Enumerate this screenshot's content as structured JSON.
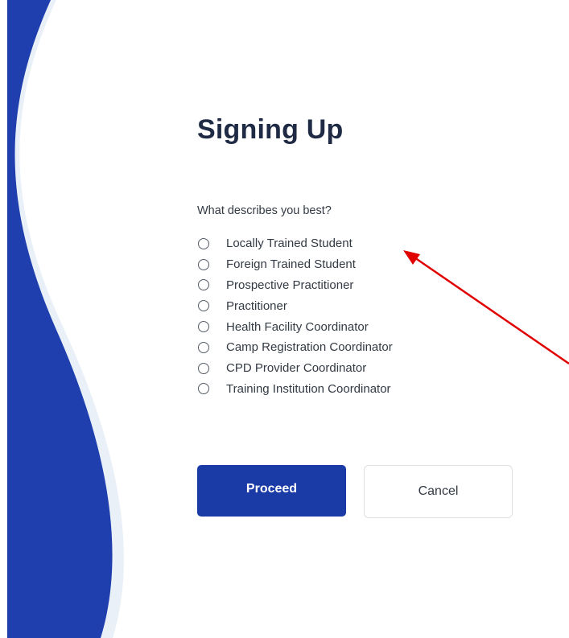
{
  "title": "Signing Up",
  "question": "What describes you best?",
  "options": [
    "Locally Trained Student",
    "Foreign Trained Student",
    "Prospective Practitioner",
    "Practitioner",
    "Health Facility Coordinator",
    "Camp Registration Coordinator",
    "CPD Provider Coordinator",
    "Training Institution Coordinator"
  ],
  "selected_option": null,
  "buttons": {
    "proceed": "Proceed",
    "cancel": "Cancel"
  },
  "colors": {
    "brand_blue": "#1a3aa6",
    "wave_blue": "#1f3fae",
    "wave_shadow": "#eaf0f8",
    "title_text": "#1f2a44",
    "annotation_arrow": "#e00000"
  }
}
